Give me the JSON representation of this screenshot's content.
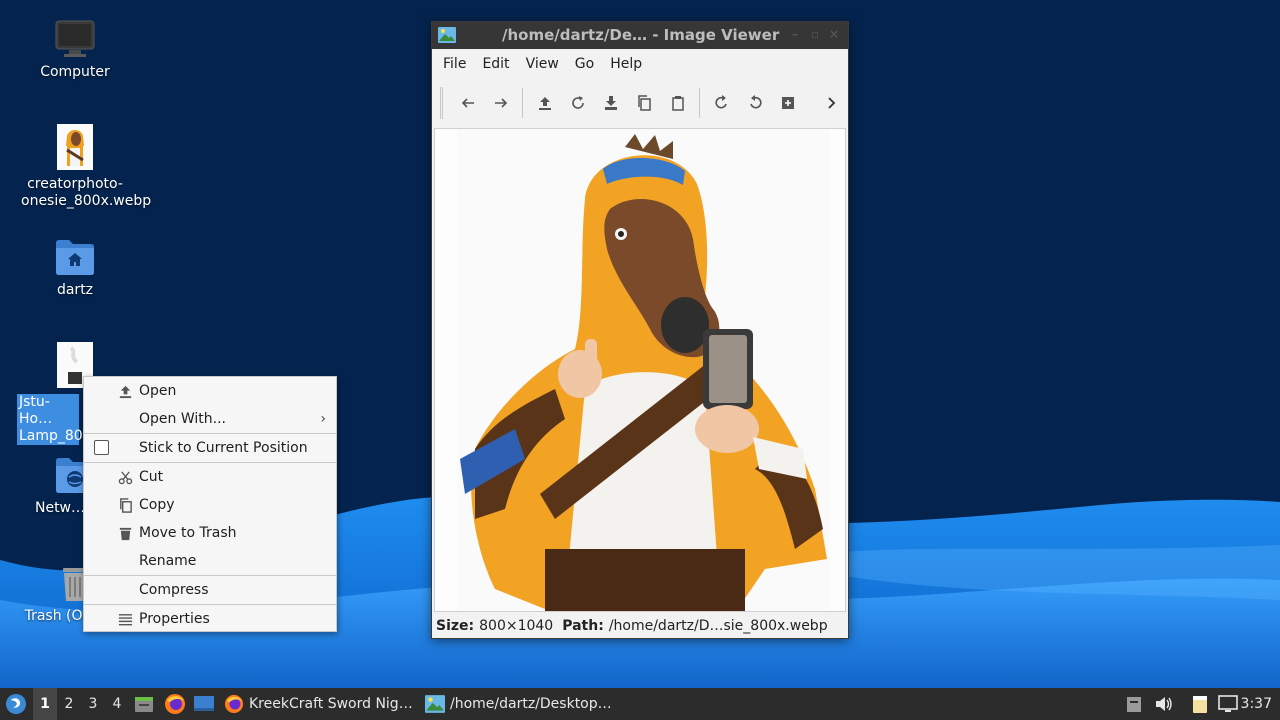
{
  "desktop": {
    "icons": [
      {
        "label": "Computer",
        "icon": "computer-icon"
      },
      {
        "label": "creatorphoto-onesie_800x.webp",
        "icon": "image-thumbnail-icon"
      },
      {
        "label": "dartz",
        "icon": "home-folder-icon"
      },
      {
        "label": "Jstu-Ho… Lamp_80…",
        "icon": "image-thumbnail-icon"
      },
      {
        "label": "Netw…",
        "icon": "network-folder-icon"
      },
      {
        "label": "Trash (On…",
        "icon": "trash-icon"
      }
    ]
  },
  "window": {
    "title": "/home/dartz/De…   - Image Viewer",
    "menu": [
      "File",
      "Edit",
      "View",
      "Go",
      "Help"
    ],
    "toolbar_icons": [
      "back-icon",
      "forward-icon",
      "open-icon",
      "reload-icon",
      "save-icon",
      "copy-icon",
      "paste-icon",
      "rotate-right-icon",
      "rotate-left-icon",
      "fit-icon",
      "overflow-icon"
    ],
    "status": {
      "size_label": "Size:",
      "size_value": "800×1040",
      "path_label": "Path:",
      "path_value": "/home/dartz/D…sie_800x.webp"
    }
  },
  "context_menu": {
    "items": [
      {
        "label": "Open",
        "icon": "open-icon"
      },
      {
        "label": "Open With...",
        "submenu": true
      },
      {
        "label": "Stick to Current Position",
        "checkbox": true,
        "checked": false
      },
      {
        "label": "Cut",
        "icon": "cut-icon"
      },
      {
        "label": "Copy",
        "icon": "copy-icon"
      },
      {
        "label": "Move to Trash",
        "icon": "trash-icon"
      },
      {
        "label": "Rename"
      },
      {
        "label": "Compress"
      },
      {
        "label": "Properties",
        "icon": "properties-icon"
      }
    ]
  },
  "taskbar": {
    "workspaces": [
      "1",
      "2",
      "3",
      "4"
    ],
    "active_workspace": "1",
    "tasks": [
      {
        "label": "KreekCraft Sword Nig…",
        "icon": "firefox-icon"
      },
      {
        "label": "/home/dartz/Desktop…",
        "icon": "image-viewer-icon"
      }
    ],
    "clock": "3:37"
  },
  "colors": {
    "wallpaper_dark": "#04244f",
    "wallpaper_wave": "#1d7fe0",
    "selection": "#3d8ee0",
    "taskbar": "#2c2c2c",
    "titlebar": "#363636"
  }
}
